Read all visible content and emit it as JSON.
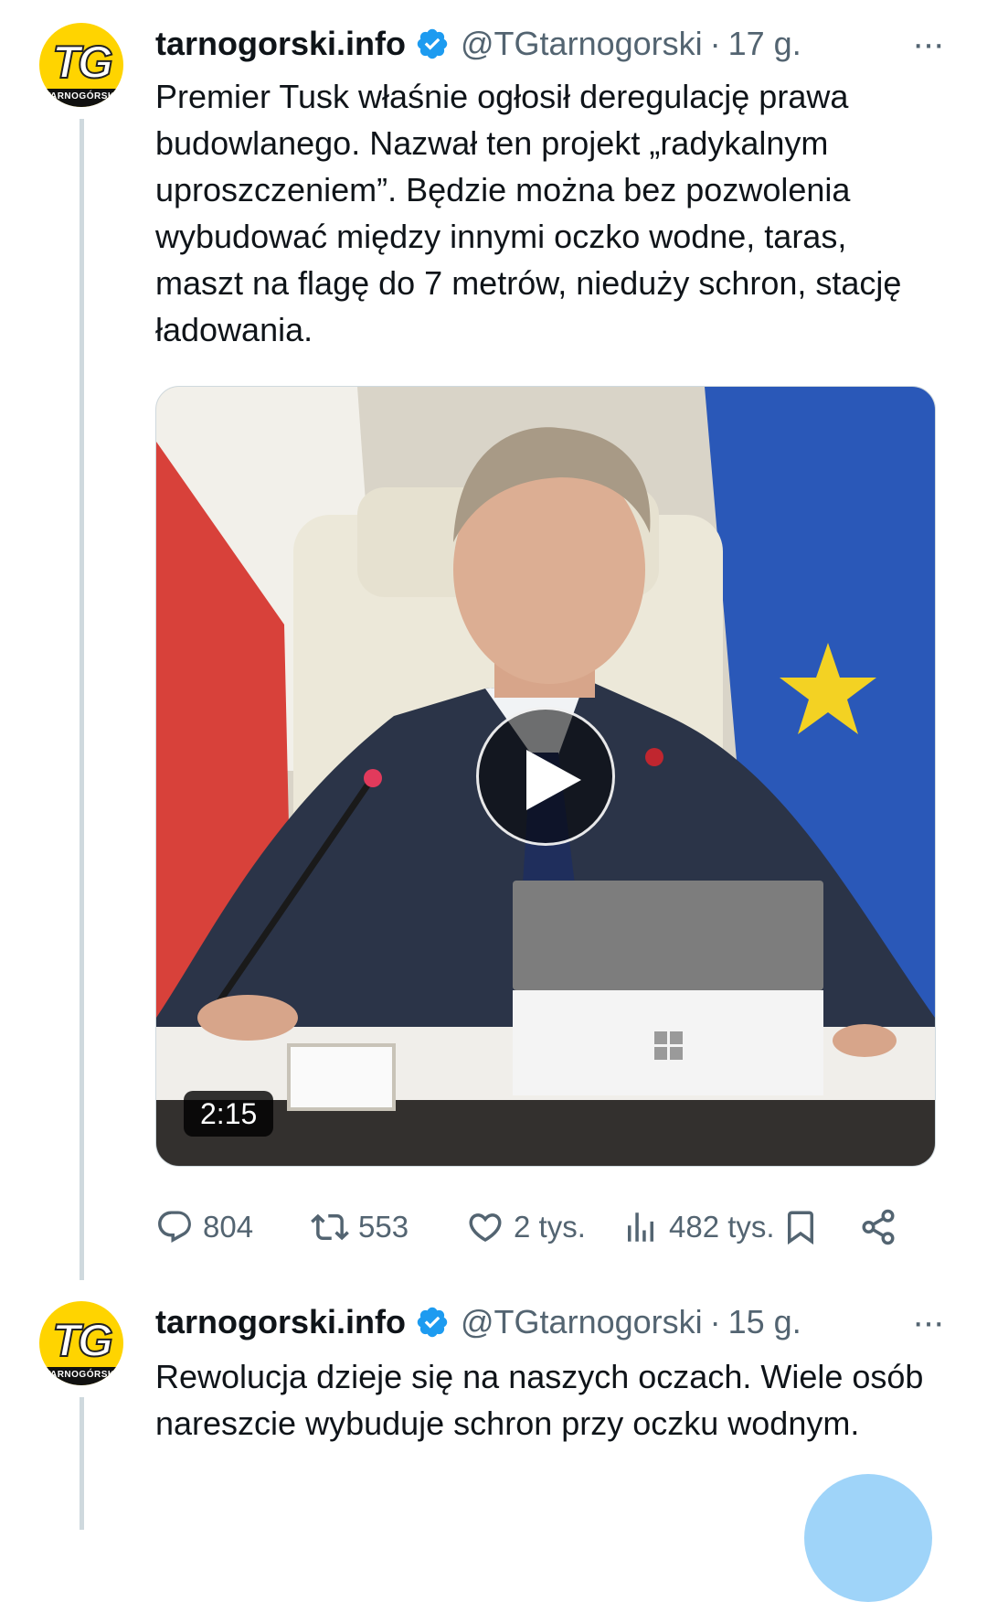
{
  "tweets": [
    {
      "author_name": "tarnogorski.info",
      "handle": "@TGtarnogorski",
      "separator": "·",
      "time": "17 g.",
      "more": "···",
      "avatar_text": "TG",
      "avatar_band": "TARNOGÓRSKI",
      "text": "Premier Tusk właśnie ogłosił deregulację prawa budowlanego. Nazwał ten projekt „radykalnym uproszczeniem”. Będzie można bez pozwolenia wybudować między innymi oczko wodne, taras, maszt na flagę do 7 metrów, nieduży schron, stację ładowania.",
      "video_duration": "2:15",
      "stats": {
        "replies": "804",
        "reposts": "553",
        "likes": "2 tys.",
        "views": "482 tys."
      }
    },
    {
      "author_name": "tarnogorski.info",
      "handle": "@TGtarnogorski",
      "separator": "·",
      "time": "15 g.",
      "more": "···",
      "avatar_text": "TG",
      "avatar_band": "TARNOGÓRSKI",
      "text": "Rewolucja dzieje się na naszych oczach. Wiele osób nareszcie wybuduje schron przy oczku wodnym."
    }
  ],
  "icons": {
    "verified": "verified-badge-icon",
    "reply": "reply-bubble-icon",
    "repost": "repost-arrows-icon",
    "like": "heart-icon",
    "views": "bar-chart-icon",
    "bookmark": "bookmark-icon",
    "share": "share-icon",
    "play": "play-icon"
  },
  "colors": {
    "accent": "#1d9bf0",
    "text": "#0f1419",
    "secondary": "#536471",
    "avatar_bg": "#ffd400"
  }
}
